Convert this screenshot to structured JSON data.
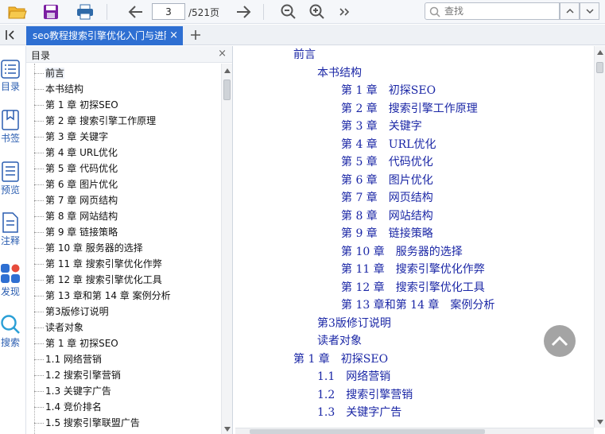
{
  "toolbar": {
    "page_current": "3",
    "page_total": "/521页",
    "search_placeholder": "查找",
    "icons": [
      "open-folder-icon",
      "save-icon",
      "print-icon",
      "arrow-left-icon",
      "arrow-right-icon",
      "zoom-out-icon",
      "zoom-in-icon",
      "more-icon",
      "search-icon",
      "chevron-up-icon",
      "chevron-down-icon"
    ]
  },
  "tabs": {
    "active_title": "seo教程搜索引擎优化入门与进阶",
    "close": "×",
    "new_tab": "+"
  },
  "rail": [
    {
      "label": "目录",
      "icon": "list-icon"
    },
    {
      "label": "书签",
      "icon": "bookmark-icon"
    },
    {
      "label": "预览",
      "icon": "thumbnails-icon"
    },
    {
      "label": "注释",
      "icon": "annotation-icon"
    },
    {
      "label": "发现",
      "icon": "discover-icon"
    },
    {
      "label": "搜索",
      "icon": "search-icon"
    }
  ],
  "toc": {
    "title": "目录",
    "close": "×",
    "items": [
      "前言",
      "本书结构",
      "第 1 章 初探SEO",
      "第 2 章 搜索引擎工作原理",
      "第 3 章 关键字",
      "第 4 章 URL优化",
      "第 5 章 代码优化",
      "第 6 章 图片优化",
      "第 7 章 网页结构",
      "第 8 章 网站结构",
      "第 9 章 链接策略",
      "第 10 章 服务器的选择",
      "第 11 章 搜索引擎优化作弊",
      "第 12 章 搜索引擎优化工具",
      "第 13 章和第 14 章 案例分析",
      "第3版修订说明",
      "读者对象",
      "第 1 章 初探SEO",
      "1.1 网络营销",
      "1.2 搜索引擎营销",
      "1.3 关键字广告",
      "1.4 竞价排名",
      "1.5 搜索引擎联盟广告"
    ]
  },
  "document": {
    "lines": [
      {
        "text": "前言",
        "level": 0
      },
      {
        "text": "本书结构",
        "level": 1
      },
      {
        "text": "第 1 章　初探SEO",
        "level": 2
      },
      {
        "text": "第 2 章　搜索引擎工作原理",
        "level": 2
      },
      {
        "text": "第 3 章　关键字",
        "level": 2
      },
      {
        "text": "第 4 章　URL优化",
        "level": 2
      },
      {
        "text": "第 5 章　代码优化",
        "level": 2
      },
      {
        "text": "第 6 章　图片优化",
        "level": 2
      },
      {
        "text": "第 7 章　网页结构",
        "level": 2
      },
      {
        "text": "第 8 章　网站结构",
        "level": 2
      },
      {
        "text": "第 9 章　链接策略",
        "level": 2
      },
      {
        "text": "第 10 章　服务器的选择",
        "level": 2
      },
      {
        "text": "第 11 章　搜索引擎优化作弊",
        "level": 2
      },
      {
        "text": "第 12 章　搜索引擎优化工具",
        "level": 2
      },
      {
        "text": "第 13 章和第 14 章　案例分析",
        "level": 2
      },
      {
        "text": "第3版修订说明",
        "level": 1
      },
      {
        "text": "读者对象",
        "level": 1
      },
      {
        "text": "第 1 章　初探SEO",
        "level": 0
      },
      {
        "text": "1.1　网络营销",
        "level": 1
      },
      {
        "text": "1.2　搜索引擎营销",
        "level": 1
      },
      {
        "text": "1.3　关键字广告",
        "level": 1
      }
    ]
  },
  "colors": {
    "accent": "#2e6fd2",
    "link": "#1b27a6",
    "rail_label": "#2a5db0"
  }
}
